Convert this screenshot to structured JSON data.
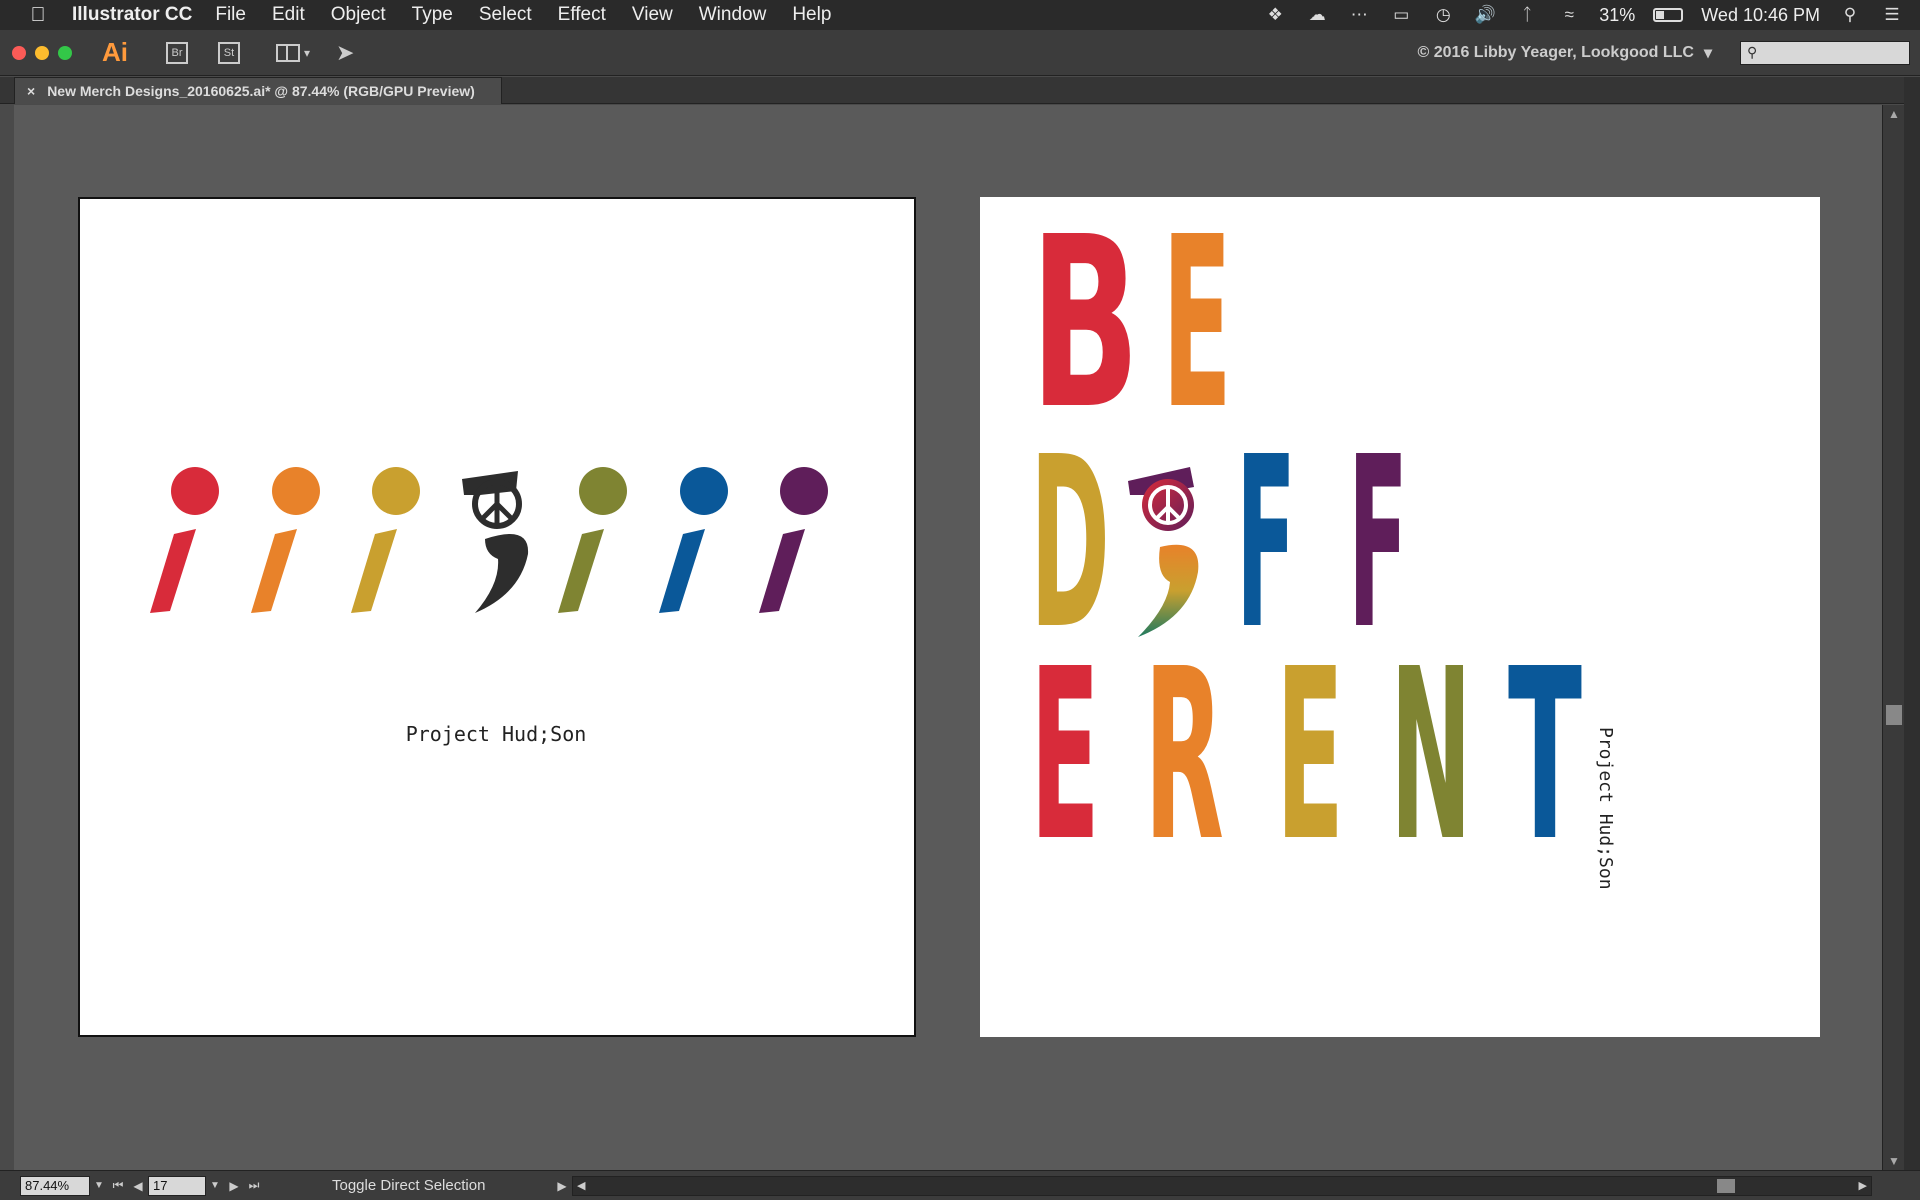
{
  "menubar": {
    "app_name": "Illustrator CC",
    "menus": [
      "File",
      "Edit",
      "Object",
      "Type",
      "Select",
      "Effect",
      "View",
      "Window",
      "Help"
    ],
    "battery": "31%",
    "datetime": "Wed 10:46 PM"
  },
  "toolbar": {
    "app_logo": "Ai",
    "bridge_label": "Br",
    "stock_label": "St",
    "workspace_label": "© 2016 Libby Yeager, Lookgood LLC",
    "search_placeholder": ""
  },
  "document": {
    "tab_title": "New Merch Designs_20160625.ai* @ 87.44% (RGB/GPU Preview)"
  },
  "artwork": {
    "left_caption": "Project Hud;Son",
    "right_caption": "Project Hud;Son",
    "right_rows": [
      {
        "letters": [
          "B",
          "E"
        ]
      },
      {
        "letters": [
          "D",
          ";",
          "F",
          "F"
        ]
      },
      {
        "letters": [
          "E",
          "R",
          "E",
          "N",
          "T"
        ]
      }
    ],
    "palette": [
      "#d82b3a",
      "#e8822a",
      "#c9a02f",
      "#2d2d2d",
      "#7f8432",
      "#0a5899",
      "#5f1e5a"
    ]
  },
  "statusbar": {
    "zoom": "87.44%",
    "page": "17",
    "status_text": "Toggle Direct Selection"
  }
}
